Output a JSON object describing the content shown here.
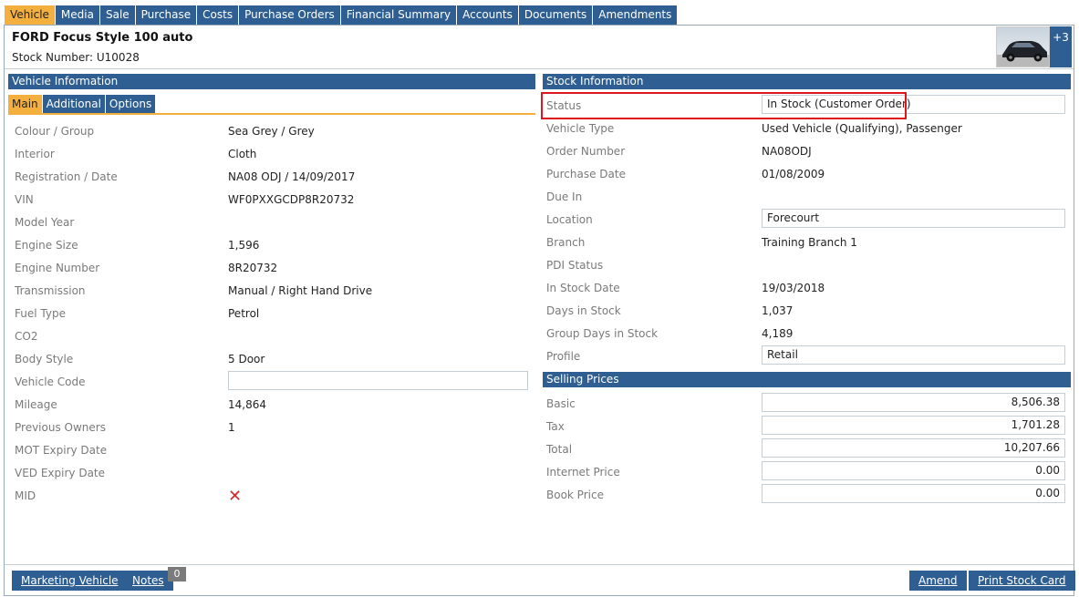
{
  "tabs": [
    "Vehicle",
    "Media",
    "Sale",
    "Purchase",
    "Costs",
    "Purchase Orders",
    "Financial Summary",
    "Accounts",
    "Documents",
    "Amendments"
  ],
  "active_tab": "Vehicle",
  "header": {
    "title": "FORD Focus Style 100 auto",
    "stock_number_label": "Stock Number: U10028",
    "image_count_badge": "+3"
  },
  "vehicle_info": {
    "section_title": "Vehicle Information",
    "subtabs": [
      "Main",
      "Additional",
      "Options"
    ],
    "active_subtab": "Main",
    "fields": {
      "colour": {
        "label": "Colour / Group",
        "value": "Sea Grey / Grey"
      },
      "interior": {
        "label": "Interior",
        "value": "Cloth"
      },
      "registration": {
        "label": "Registration / Date",
        "value": "NA08 ODJ / 14/09/2017"
      },
      "vin": {
        "label": "VIN",
        "value": "WF0PXXGCDP8R20732"
      },
      "model_year": {
        "label": "Model Year",
        "value": ""
      },
      "engine_size": {
        "label": "Engine Size",
        "value": "1,596"
      },
      "engine_number": {
        "label": "Engine Number",
        "value": "8R20732"
      },
      "transmission": {
        "label": "Transmission",
        "value": "Manual / Right Hand Drive"
      },
      "fuel_type": {
        "label": "Fuel Type",
        "value": "Petrol"
      },
      "co2": {
        "label": "CO2",
        "value": ""
      },
      "body_style": {
        "label": "Body Style",
        "value": "5 Door"
      },
      "vehicle_code": {
        "label": "Vehicle Code",
        "value": ""
      },
      "mileage": {
        "label": "Mileage",
        "value": "14,864"
      },
      "previous_owners": {
        "label": "Previous Owners",
        "value": "1"
      },
      "mot_expiry": {
        "label": "MOT Expiry Date",
        "value": ""
      },
      "ved_expiry": {
        "label": "VED Expiry Date",
        "value": ""
      },
      "mid": {
        "label": "MID",
        "value": "✕"
      }
    }
  },
  "stock_info": {
    "section_title": "Stock Information",
    "fields": {
      "status": {
        "label": "Status",
        "value": "In Stock (Customer Order)"
      },
      "vehicle_type": {
        "label": "Vehicle Type",
        "value": "Used Vehicle (Qualifying), Passenger"
      },
      "order_number": {
        "label": "Order Number",
        "value": "NA08ODJ"
      },
      "purchase_date": {
        "label": "Purchase Date",
        "value": "01/08/2009"
      },
      "due_in": {
        "label": "Due In",
        "value": ""
      },
      "location": {
        "label": "Location",
        "value": "Forecourt"
      },
      "branch": {
        "label": "Branch",
        "value": "Training Branch 1"
      },
      "pdi_status": {
        "label": "PDI Status",
        "value": ""
      },
      "in_stock_date": {
        "label": "In Stock Date",
        "value": "19/03/2018"
      },
      "days_in_stock": {
        "label": "Days in Stock",
        "value": "1,037"
      },
      "group_days_in_stock": {
        "label": "Group Days in Stock",
        "value": "4,189"
      },
      "profile": {
        "label": "Profile",
        "value": "Retail"
      }
    }
  },
  "selling_prices": {
    "section_title": "Selling Prices",
    "fields": {
      "basic": {
        "label": "Basic",
        "value": "8,506.38"
      },
      "tax": {
        "label": "Tax",
        "value": "1,701.28"
      },
      "total": {
        "label": "Total",
        "value": "10,207.66"
      },
      "internet_price": {
        "label": "Internet Price",
        "value": "0.00"
      },
      "book_price": {
        "label": "Book Price",
        "value": "0.00"
      }
    }
  },
  "footer": {
    "marketing_vehicle": "Marketing Vehicle",
    "notes": "Notes",
    "notes_count": "0",
    "amend": "Amend",
    "print_stock_card": "Print Stock Card"
  },
  "colors": {
    "primary_blue": "#2f5f92",
    "active_tab": "#f4b03e",
    "highlight_red": "#e0161b",
    "label_grey": "#7a7a7a"
  }
}
